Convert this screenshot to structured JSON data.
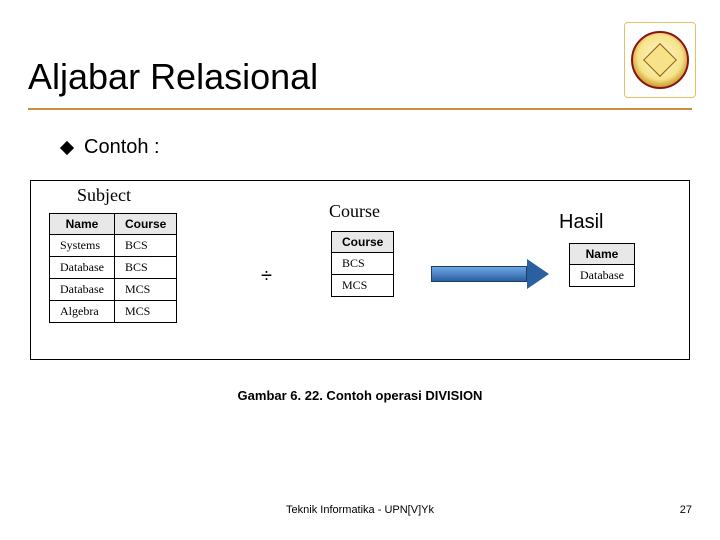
{
  "title": "Aljabar Relasional",
  "bullet": "Contoh :",
  "labels": {
    "subject": "Subject",
    "course": "Course",
    "hasil": "Hasil"
  },
  "division_symbol": "÷",
  "subject_table": {
    "headers": [
      "Name",
      "Course"
    ],
    "rows": [
      [
        "Systems",
        "BCS"
      ],
      [
        "Database",
        "BCS"
      ],
      [
        "Database",
        "MCS"
      ],
      [
        "Algebra",
        "MCS"
      ]
    ]
  },
  "course_table": {
    "headers": [
      "Course"
    ],
    "rows": [
      [
        "BCS"
      ],
      [
        "MCS"
      ]
    ]
  },
  "result_table": {
    "headers": [
      "Name"
    ],
    "rows": [
      [
        "Database"
      ]
    ]
  },
  "caption": "Gambar 6. 22. Contoh operasi DIVISION",
  "footer": {
    "center": "Teknik Informatika - UPN[V]Yk",
    "page": "27"
  }
}
